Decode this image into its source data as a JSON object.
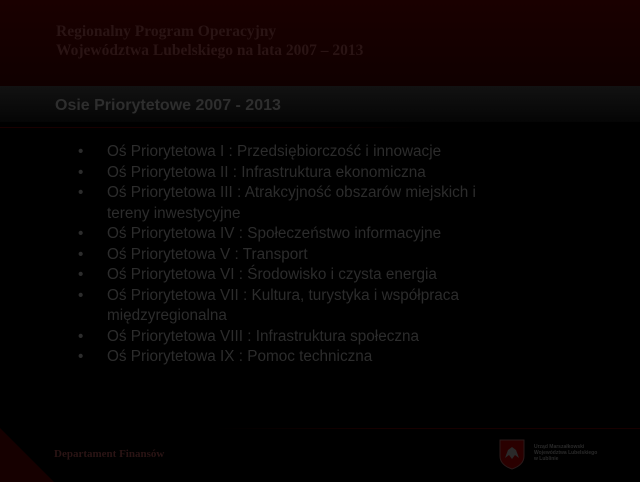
{
  "header": {
    "title_line1": "Regionalny Program Operacyjny",
    "title_line2": "Województwa Lubelskiego na lata 2007 – 2013"
  },
  "slide": {
    "title": "Osie Priorytetowe 2007 - 2013",
    "bullet_symbol": "•",
    "items": [
      "Oś Priorytetowa I : Przedsiębiorczość i innowacje",
      "Oś Priorytetowa II : Infrastruktura ekonomiczna",
      "Oś Priorytetowa III : Atrakcyjność obszarów miejskich i tereny inwestycyjne",
      "Oś Priorytetowa IV : Społeczeństwo informacyjne",
      "Oś Priorytetowa V : Transport",
      "Oś Priorytetowa VI : Środowisko i czysta energia",
      "Oś Priorytetowa VII : Kultura, turystyka i współpraca międzyregionalna",
      "Oś Priorytetowa VIII : Infrastruktura społeczna",
      "Oś Priorytetowa IX : Pomoc techniczna"
    ]
  },
  "footer": {
    "department": "Departament Finansów",
    "org_line1": "Urząd Marszałkowski",
    "org_line2": "Województwa Lubelskiego",
    "org_line3": "w Lublinie"
  },
  "colors": {
    "background": "#000000",
    "header": "#1a0000",
    "text": "#2c2c2c",
    "accent": "#2a1414"
  },
  "icons": {
    "crest": "coat-of-arms-icon"
  }
}
